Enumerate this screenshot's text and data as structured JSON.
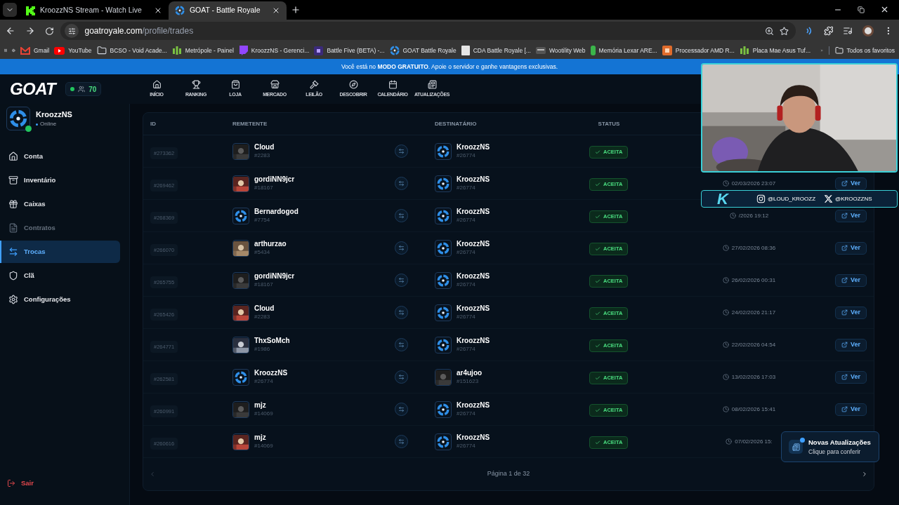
{
  "browser": {
    "tabs": [
      {
        "title": "KroozzNS Stream - Watch Live",
        "kind": "kick",
        "selected": false
      },
      {
        "title": "GOAT - Battle Royale",
        "kind": "target",
        "selected": true
      }
    ],
    "url_host": "goatroyale.com",
    "url_path": "/profile/trades",
    "bookmarks": [
      {
        "label": "Gmail",
        "kind": "gmail"
      },
      {
        "label": "YouTube",
        "kind": "youtube"
      },
      {
        "label": "BCSO - Void Acade...",
        "kind": "folder"
      },
      {
        "label": "Metrópole - Painel",
        "kind": "bars"
      },
      {
        "label": "KroozzNS - Gerenci...",
        "kind": "twitch"
      },
      {
        "label": "Battle Five (BETA) -...",
        "kind": "square"
      },
      {
        "label": "GOAT Battle Royale",
        "kind": "target"
      },
      {
        "label": "CDA Battle Royale [...",
        "kind": "page"
      },
      {
        "label": "Wootility Web",
        "kind": "keyboard"
      },
      {
        "label": "Memória Lexar ARE...",
        "kind": "pin"
      },
      {
        "label": "Processador AMD R...",
        "kind": "chip"
      },
      {
        "label": "Placa Mae Asus Tuf...",
        "kind": "bars"
      }
    ],
    "all_bookmarks": "Todos os favoritos"
  },
  "banner": "Você está no **MODO GRATUITO**. Apoie o servidor e ganhe vantagens exclusivas.",
  "header": {
    "logo": "GOAT",
    "online_count": "70",
    "nav": [
      {
        "label": "INÍCIO",
        "kind": "home"
      },
      {
        "label": "RANKING",
        "kind": "trophy"
      },
      {
        "label": "LOJA",
        "kind": "bag"
      },
      {
        "label": "MERCADO",
        "kind": "store"
      },
      {
        "label": "LEILÃO",
        "kind": "gavel"
      },
      {
        "label": "DESCOBRIR",
        "kind": "compass"
      },
      {
        "label": "CALENDÁRIO",
        "kind": "calendar"
      },
      {
        "label": "ATUALIZAÇÕES",
        "kind": "news"
      }
    ]
  },
  "profile": {
    "name": "KroozzNS",
    "status": "Online",
    "online": true
  },
  "sidebar": {
    "items": [
      {
        "label": "Conta",
        "kind": "home",
        "selected": false,
        "disabled": false
      },
      {
        "label": "Inventário",
        "kind": "archive",
        "selected": false,
        "disabled": false
      },
      {
        "label": "Caixas",
        "kind": "gift",
        "selected": false,
        "disabled": false
      },
      {
        "label": "Contratos",
        "kind": "file",
        "selected": false,
        "disabled": true
      },
      {
        "label": "Trocas",
        "kind": "swap",
        "selected": true,
        "disabled": false
      },
      {
        "label": "Clã",
        "kind": "shield",
        "selected": false,
        "disabled": false
      },
      {
        "label": "Configurações",
        "kind": "gear",
        "selected": false,
        "disabled": false
      }
    ],
    "logout": "Sair"
  },
  "table": {
    "columns": [
      "ID",
      "REMETENTE",
      "DESTINATÁRIO",
      "STATUS"
    ],
    "rows": [
      {
        "id": "#273362",
        "sender": {
          "name": "Cloud",
          "tag": "#2283"
        },
        "recipient": {
          "name": "KroozzNS",
          "tag": "#26774",
          "kind": "logo"
        },
        "status": "ACEITA"
      },
      {
        "id": "#269462",
        "sender": {
          "name": "gordiNN9jcr",
          "tag": "#18167"
        },
        "recipient": {
          "name": "KroozzNS",
          "tag": "#26774",
          "kind": "logo"
        },
        "status": "ACEITA",
        "date": "02/03/2026 23:07",
        "view": "Ver"
      },
      {
        "id": "#268369",
        "sender": {
          "name": "Bernardogod",
          "tag": "#7754",
          "kind": "logo"
        },
        "recipient": {
          "name": "KroozzNS",
          "tag": "#26774",
          "kind": "logo"
        },
        "status": "ACEITA",
        "date": "/2026 19:12",
        "view": "Ver"
      },
      {
        "id": "#266070",
        "sender": {
          "name": "arthurzao",
          "tag": "#5434"
        },
        "recipient": {
          "name": "KroozzNS",
          "tag": "#26774",
          "kind": "logo"
        },
        "status": "ACEITA",
        "date": "27/02/2026 08:36",
        "view": "Ver"
      },
      {
        "id": "#265755",
        "sender": {
          "name": "gordiNN9jcr",
          "tag": "#18167"
        },
        "recipient": {
          "name": "KroozzNS",
          "tag": "#26774",
          "kind": "logo"
        },
        "status": "ACEITA",
        "date": "26/02/2026 00:31",
        "view": "Ver"
      },
      {
        "id": "#265426",
        "sender": {
          "name": "Cloud",
          "tag": "#2283"
        },
        "recipient": {
          "name": "KroozzNS",
          "tag": "#26774",
          "kind": "logo"
        },
        "status": "ACEITA",
        "date": "24/02/2026 21:17",
        "view": "Ver"
      },
      {
        "id": "#264771",
        "sender": {
          "name": "ThxSoMch",
          "tag": "#1986"
        },
        "recipient": {
          "name": "KroozzNS",
          "tag": "#26774",
          "kind": "logo"
        },
        "status": "ACEITA",
        "date": "22/02/2026 04:54",
        "view": "Ver"
      },
      {
        "id": "#262581",
        "sender": {
          "name": "KroozzNS",
          "tag": "#26774",
          "kind": "logo"
        },
        "recipient": {
          "name": "ar4ujoo",
          "tag": "#151623"
        },
        "status": "ACEITA",
        "date": "13/02/2026 17:03",
        "view": "Ver"
      },
      {
        "id": "#260991",
        "sender": {
          "name": "mjz",
          "tag": "#14069"
        },
        "recipient": {
          "name": "KroozzNS",
          "tag": "#26774",
          "kind": "logo"
        },
        "status": "ACEITA",
        "date": "08/02/2026 15:41",
        "view": "Ver"
      },
      {
        "id": "#260616",
        "sender": {
          "name": "mjz",
          "tag": "#14069"
        },
        "recipient": {
          "name": "KroozzNS",
          "tag": "#26774",
          "kind": "logo"
        },
        "status": "ACEITA",
        "date": "07/02/2026 15:"
      }
    ]
  },
  "pagination": "Página 1 de 32",
  "stream_overlay": {
    "logo_letter": "K",
    "instagram": "@LOUD_KROOZZ",
    "x": "@KROOZZNS"
  },
  "toast": {
    "title": "Novas Atualizações",
    "subtitle": "Clique para conferir",
    "unread": true
  }
}
